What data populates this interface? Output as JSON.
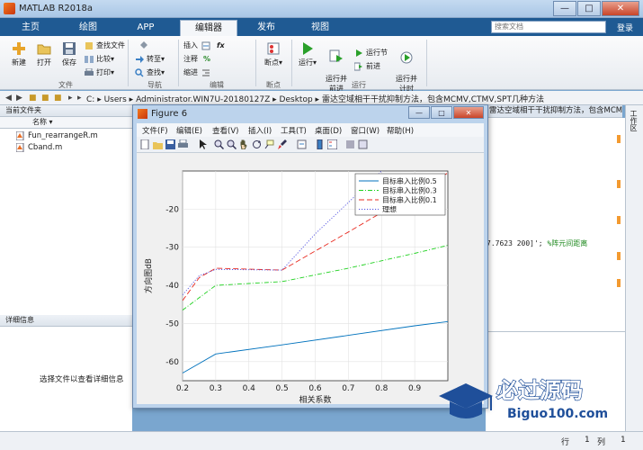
{
  "app": {
    "title": "MATLAB R2018a"
  },
  "window_controls": {
    "minimize": "—",
    "maximize": "□",
    "close": "✕"
  },
  "tabs": [
    {
      "label": "主页",
      "active": false
    },
    {
      "label": "绘图",
      "active": false
    },
    {
      "label": "APP",
      "active": false
    },
    {
      "label": "编辑器",
      "active": true
    },
    {
      "label": "发布",
      "active": false
    },
    {
      "label": "视图",
      "active": false
    }
  ],
  "search": {
    "placeholder": "搜索文档"
  },
  "login": "登录",
  "ribbon": {
    "file": {
      "new": "新建",
      "open": "打开",
      "save": "保存",
      "find_files": "查找文件",
      "compare": "比较",
      "print": "打印",
      "group": "文件"
    },
    "navigate": {
      "goto": "转至",
      "find": "查找",
      "group": "导航"
    },
    "edit": {
      "insert": "插入",
      "comment": "注释",
      "indent": "缩进",
      "fx": "fx",
      "group": "编辑"
    },
    "breakpoints": {
      "label": "断点",
      "group": "断点"
    },
    "run": {
      "run": "运行",
      "run_advance": "运行并\n前进",
      "run_section": "运行节",
      "advance": "前进",
      "run_time": "运行并\n计时",
      "group": "运行"
    }
  },
  "address": {
    "crumbs": [
      "C:",
      "Users",
      "Administrator.WIN7U-20180127Z",
      "Desktop",
      "雷达空域相干干扰抑制方法，包含MCMV,CTMV,SPT几种方法"
    ]
  },
  "current_folder": {
    "title": "当前文件夹",
    "column": "名称",
    "files": [
      "Fun_rearrangeR.m",
      "Cband.m"
    ]
  },
  "details": {
    "title": "详细信息",
    "message": "选择文件以查看详细信息"
  },
  "editor": {
    "tab_title": "雷达空域相干干扰抑制方法，包含MCMV,CTMV,SPT几种",
    "code_value": "7.7623 200]';",
    "code_comment": "%阵元间距离"
  },
  "workspace": {
    "label": "工作区"
  },
  "status": {
    "row_label": "行",
    "row": "1",
    "col_label": "列",
    "col": "1"
  },
  "figure": {
    "title": "Figure 6",
    "menu": [
      "文件(F)",
      "编辑(E)",
      "查看(V)",
      "插入(I)",
      "工具(T)",
      "桌面(D)",
      "窗口(W)",
      "帮助(H)"
    ]
  },
  "watermark": {
    "text": "必过源码",
    "url": "Biguo100.com"
  },
  "colors": {
    "blue": "#0072bd",
    "green": "#1fd11f",
    "red": "#e8281e",
    "dotted": "#5050e0"
  },
  "chart_data": {
    "type": "line",
    "xlabel": "相关系数",
    "ylabel": "方向图dB",
    "xlim": [
      0.2,
      1.0
    ],
    "ylim": [
      -65,
      -10
    ],
    "xticks": [
      "0.2",
      "0.3",
      "0.4",
      "0.5",
      "0.6",
      "0.7",
      "0.8",
      "0.9"
    ],
    "yticks": [
      "-60",
      "-50",
      "-40",
      "-30",
      "-20"
    ],
    "grid": true,
    "legend_position": "top-right",
    "series": [
      {
        "name": "目标串入比例0.5",
        "style": "solid",
        "x": [
          0.2,
          0.3,
          0.5,
          0.7,
          0.9,
          1.0
        ],
        "y": [
          -63,
          -58,
          -55.6,
          -53.1,
          -50.6,
          -49.5
        ]
      },
      {
        "name": "目标串入比例0.3",
        "style": "dashdot",
        "x": [
          0.2,
          0.3,
          0.5,
          0.7,
          0.9,
          1.0
        ],
        "y": [
          -46.5,
          -40,
          -39,
          -35.5,
          -31.6,
          -29.5
        ]
      },
      {
        "name": "目标串入比例0.1",
        "style": "dashed",
        "x": [
          0.2,
          0.25,
          0.3,
          0.5,
          0.7,
          0.9,
          1.0
        ],
        "y": [
          -44,
          -38,
          -35.5,
          -36,
          -26,
          -15.8,
          -10.5
        ]
      },
      {
        "name": "理想",
        "style": "dotted",
        "x": [
          0.2,
          0.25,
          0.3,
          0.5,
          0.6,
          0.8
        ],
        "y": [
          -42.5,
          -37.5,
          -35.8,
          -36,
          -26.5,
          -10
        ]
      }
    ]
  }
}
